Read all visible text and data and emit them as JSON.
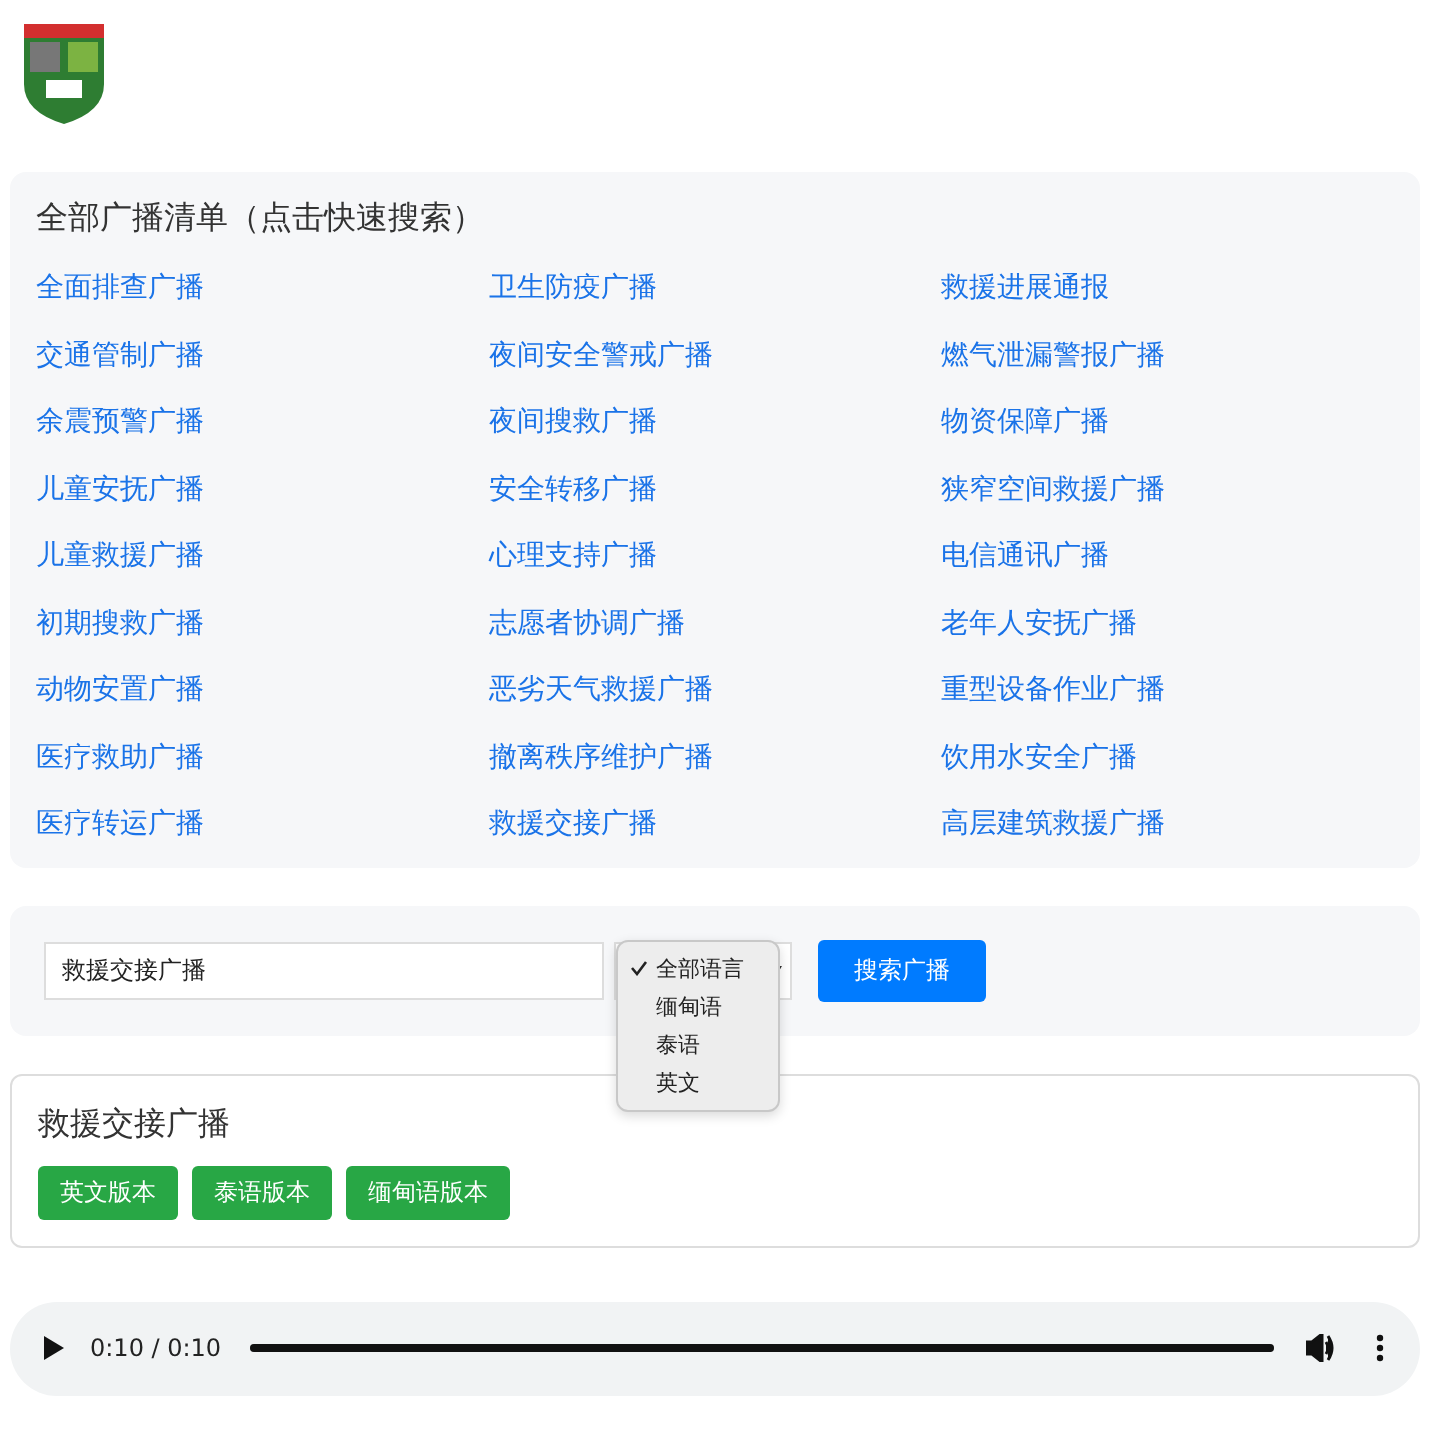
{
  "list_panel": {
    "title": "全部广播清单（点击快速搜索）",
    "links": [
      "全面排查广播",
      "卫生防疫广播",
      "救援进展通报",
      "交通管制广播",
      "夜间安全警戒广播",
      "燃气泄漏警报广播",
      "余震预警广播",
      "夜间搜救广播",
      "物资保障广播",
      "儿童安抚广播",
      "安全转移广播",
      "狭窄空间救援广播",
      "儿童救援广播",
      "心理支持广播",
      "电信通讯广播",
      "初期搜救广播",
      "志愿者协调广播",
      "老年人安抚广播",
      "动物安置广播",
      "恶劣天气救援广播",
      "重型设备作业广播",
      "医疗救助广播",
      "撤离秩序维护广播",
      "饮用水安全广播",
      "医疗转运广播",
      "救援交接广播",
      "高层建筑救援广播"
    ]
  },
  "search": {
    "value": "救援交接广播",
    "button": "搜索广播",
    "language_options": [
      {
        "label": "全部语言",
        "selected": true
      },
      {
        "label": "缅甸语",
        "selected": false
      },
      {
        "label": "泰语",
        "selected": false
      },
      {
        "label": "英文",
        "selected": false
      }
    ]
  },
  "result": {
    "title": "救援交接广播",
    "buttons": [
      "英文版本",
      "泰语版本",
      "缅甸语版本"
    ]
  },
  "audio": {
    "time": "0:10 / 0:10",
    "level": 1
  }
}
